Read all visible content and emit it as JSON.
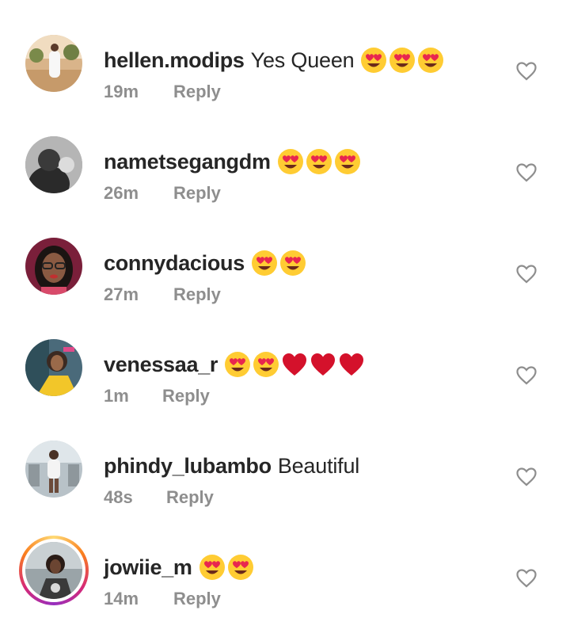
{
  "comments": [
    {
      "username": "hellen.modips",
      "text": "Yes Queen",
      "emojis": [
        "heart-eyes",
        "heart-eyes",
        "heart-eyes"
      ],
      "time": "19m",
      "reply": "Reply",
      "avatar": "photo-outdoor-white-dress"
    },
    {
      "username": "nametsegangdm",
      "text": "",
      "emojis": [
        "heart-eyes",
        "heart-eyes",
        "heart-eyes"
      ],
      "time": "26m",
      "reply": "Reply",
      "avatar": "photo-grayscale-portrait"
    },
    {
      "username": "connydacious",
      "text": "",
      "emojis": [
        "heart-eyes",
        "heart-eyes"
      ],
      "time": "27m",
      "reply": "Reply",
      "avatar": "photo-woman-glasses"
    },
    {
      "username": "venessaa_r",
      "text": "",
      "emojis": [
        "heart-eyes",
        "heart-eyes",
        "red-heart",
        "red-heart",
        "red-heart"
      ],
      "time": "1m",
      "reply": "Reply",
      "avatar": "photo-woman-yellow"
    },
    {
      "username": "phindy_lubambo",
      "text": "Beautiful",
      "emojis": [],
      "time": "48s",
      "reply": "Reply",
      "avatar": "photo-woman-white-outfit"
    },
    {
      "username": "jowiie_m",
      "text": "",
      "emojis": [
        "heart-eyes",
        "heart-eyes"
      ],
      "time": "14m",
      "reply": "Reply",
      "avatar": "photo-story-ring"
    }
  ],
  "colors": {
    "username": "#262626",
    "meta": "#8e8e8e",
    "heart_outline": "#8e8e8e",
    "emoji_face": "#ffcc33",
    "emoji_heart": "#e8264f"
  }
}
